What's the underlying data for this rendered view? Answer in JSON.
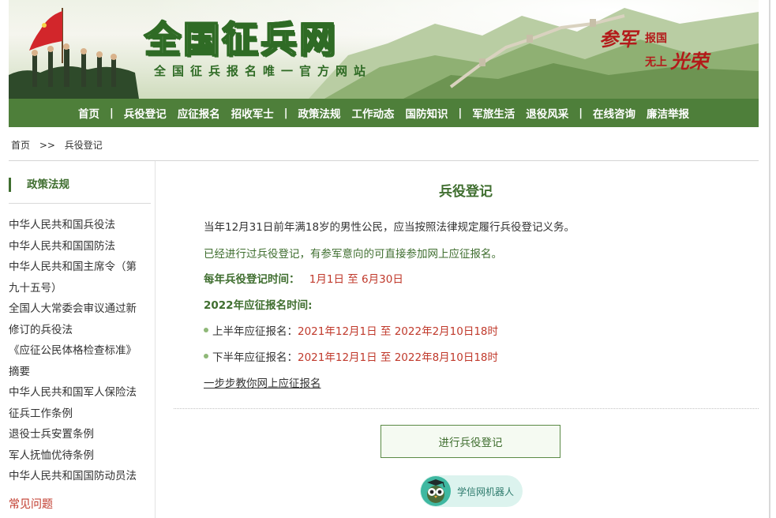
{
  "header": {
    "site_title": "全国征兵网",
    "site_subtitle": "全国征兵报名唯一官方网站",
    "slogan": {
      "part1": "参军",
      "part2": "报国",
      "part3": "无上",
      "part4": "光荣"
    }
  },
  "nav": {
    "items": [
      "首页",
      "兵役登记",
      "应征报名",
      "招收军士",
      "政策法规",
      "工作动态",
      "国防知识",
      "军旅生活",
      "退役风采",
      "在线咨询",
      "廉洁举报"
    ],
    "separator": "|"
  },
  "breadcrumb": {
    "home": "首页",
    "sep": ">>",
    "current": "兵役登记"
  },
  "sidebar": {
    "title": "政策法规",
    "items": [
      "中华人民共和国兵役法",
      "中华人民共和国国防法",
      "中华人民共和国主席令（第",
      "九十五号）",
      "全国人大常委会审议通过新",
      "修订的兵役法",
      "《应征公民体格检查标准》",
      "摘要",
      "中华人民共和国军人保险法",
      "征兵工作条例",
      "退役士兵安置条例",
      "军人抚恤优待条例",
      "中华人民共和国国防动员法"
    ],
    "next_section": "常见问题"
  },
  "main": {
    "title": "兵役登记",
    "para1": "当年12月31日前年满18岁的男性公民，应当按照法律规定履行兵役登记义务。",
    "para2": "已经进行过兵役登记，有参军意向的可直接参加网上应征报名。",
    "reg_time_label": "每年兵役登记时间：",
    "reg_time_value": "1月1日 至 6月30日",
    "enlist_label": "2022年应征报名时间:",
    "first_half_label": "上半年应征报名：",
    "first_half_value": "2021年12月1日 至 2022年2月10日18时",
    "second_half_label": "下半年应征报名：",
    "second_half_value": "2021年12月1日 至 2022年8月10日18时",
    "guide_link": "一步步教你网上应征报名",
    "register_button": "进行兵役登记",
    "robot_label": "学信网机器人"
  },
  "colors": {
    "brand_green": "#4e7f3a",
    "accent_red": "#c0392b"
  }
}
